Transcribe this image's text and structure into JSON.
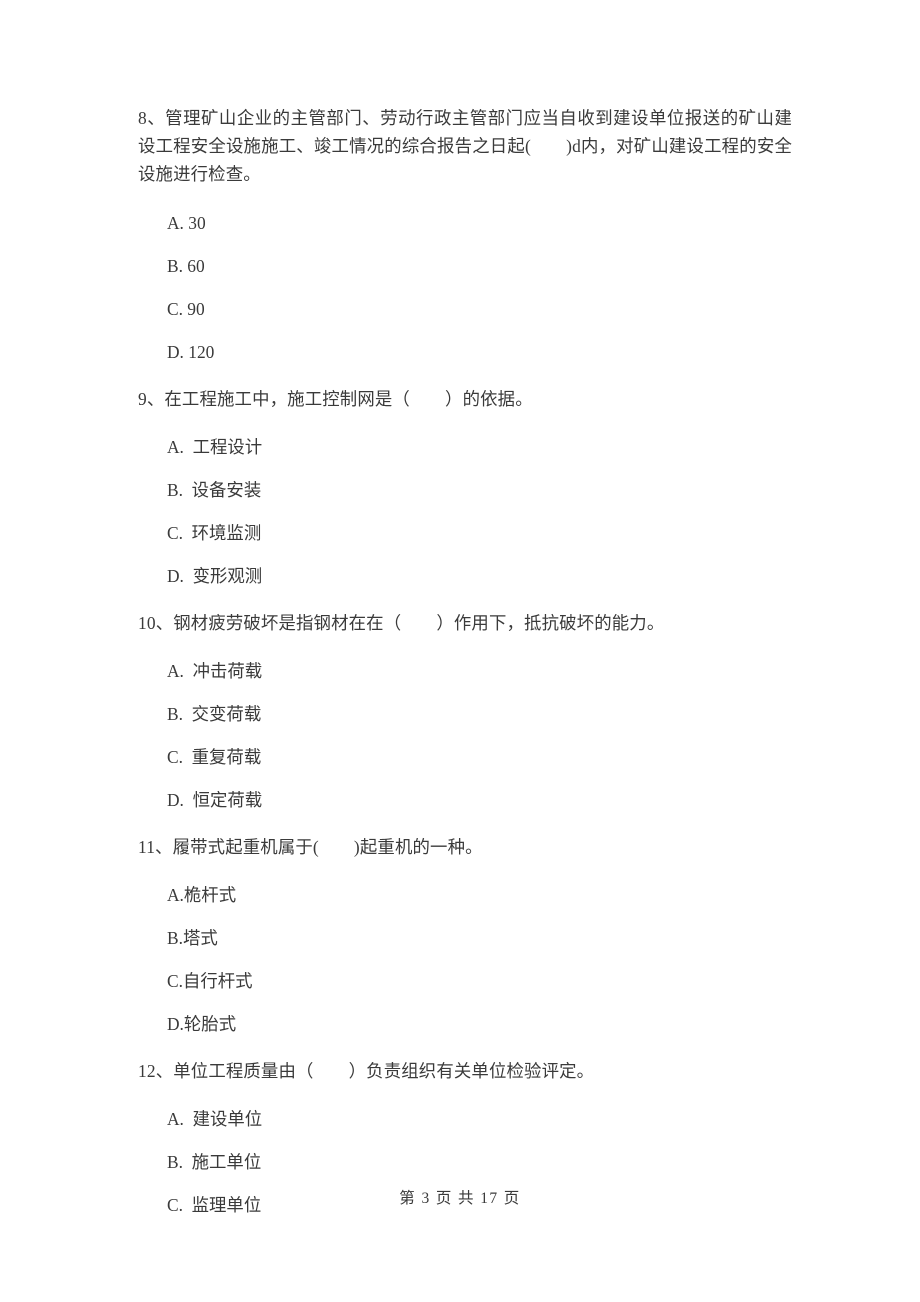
{
  "document": {
    "type": "exam-paper",
    "language": "zh-CN",
    "background_color": "#ffffff",
    "text_color": "#3a3a3a"
  },
  "questions": [
    {
      "number": "8",
      "stem": "8、管理矿山企业的主管部门、劳动行政主管部门应当自收到建设单位报送的矿山建设工程安全设施施工、竣工情况的综合报告之日起(　　)d内，对矿山建设工程的安全设施进行检查。",
      "options": [
        "A. 30",
        "B. 60",
        "C. 90",
        "D. 120"
      ]
    },
    {
      "number": "9",
      "stem": "9、在工程施工中，施工控制网是（　　）的依据。",
      "options": [
        "A.  工程设计",
        "B.  设备安装",
        "C.  环境监测",
        "D.  变形观测"
      ]
    },
    {
      "number": "10",
      "stem": "10、钢材疲劳破坏是指钢材在在（　　）作用下，抵抗破坏的能力。",
      "options": [
        "A.  冲击荷载",
        "B.  交变荷载",
        "C.  重复荷载",
        "D.  恒定荷载"
      ]
    },
    {
      "number": "11",
      "stem": "11、履带式起重机属于(　　)起重机的一种。",
      "options": [
        "A.桅杆式",
        "B.塔式",
        "C.自行杆式",
        "D.轮胎式"
      ]
    },
    {
      "number": "12",
      "stem": "12、单位工程质量由（　　）负责组织有关单位检验评定。",
      "options": [
        "A.  建设单位",
        "B.  施工单位",
        "C.  监理单位"
      ]
    }
  ],
  "footer": {
    "text": "第 3 页 共 17 页",
    "current_page": "3",
    "total_pages": "17"
  }
}
